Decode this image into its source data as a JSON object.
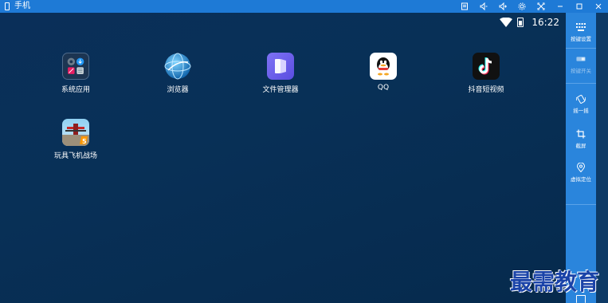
{
  "window": {
    "title": "手机",
    "controls": [
      "menu-icon",
      "volume-down-icon",
      "volume-up-icon",
      "settings-icon",
      "fullscreen-icon",
      "minimize-icon",
      "maximize-icon",
      "close-icon"
    ]
  },
  "status_bar": {
    "time": "16:22",
    "icons": [
      "wifi-icon",
      "battery-icon"
    ]
  },
  "apps": [
    {
      "label": "系统应用",
      "icon": "system-apps-folder-icon"
    },
    {
      "label": "浏览器",
      "icon": "browser-icon"
    },
    {
      "label": "文件管理器",
      "icon": "file-manager-icon"
    },
    {
      "label": "QQ",
      "icon": "qq-icon"
    },
    {
      "label": "抖音短视频",
      "icon": "douyin-icon"
    },
    {
      "label": "玩具飞机战场",
      "icon": "toy-plane-game-icon"
    }
  ],
  "sidebar": {
    "items": [
      {
        "label": "按键设置",
        "icon": "keyboard-icon",
        "enabled": true
      },
      {
        "label": "按键开关",
        "icon": "toggle-icon",
        "enabled": false
      },
      {
        "label": "摇一摇",
        "icon": "shake-icon",
        "enabled": true
      },
      {
        "label": "截屏",
        "icon": "crop-icon",
        "enabled": true
      },
      {
        "label": "虚拟定位",
        "icon": "location-icon",
        "enabled": true
      }
    ]
  },
  "watermark": "最需教育",
  "colors": {
    "titlebar": "#1e7ad6",
    "sidebar": "#2a85dc",
    "desktop": "#0a2f59",
    "watermark": "#1a43a8"
  }
}
